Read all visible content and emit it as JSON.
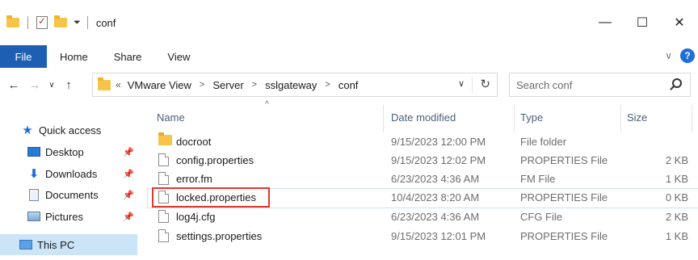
{
  "window": {
    "title": "conf",
    "controls": {
      "minimize": "—",
      "maximize": "☐",
      "close": "✕"
    }
  },
  "ribbon": {
    "tabs": [
      "File",
      "Home",
      "Share",
      "View"
    ],
    "collapse_glyph": "∨",
    "help_glyph": "?"
  },
  "nav": {
    "back": "←",
    "forward": "→",
    "recent": "∨",
    "up": "↑"
  },
  "address": {
    "overflow": "«",
    "crumbs": [
      "VMware View",
      "Server",
      "sslgateway",
      "conf"
    ],
    "dropdown": "∨",
    "refresh": "↻"
  },
  "search": {
    "placeholder": "Search conf"
  },
  "sidebar": {
    "items": [
      {
        "label": "Quick access",
        "icon": "star-icon"
      },
      {
        "label": "Desktop",
        "icon": "desktop-icon",
        "pinned": true
      },
      {
        "label": "Downloads",
        "icon": "downloads-icon",
        "pinned": true
      },
      {
        "label": "Documents",
        "icon": "documents-icon",
        "pinned": true
      },
      {
        "label": "Pictures",
        "icon": "pictures-icon",
        "pinned": true
      },
      {
        "label": "This PC",
        "icon": "pc-icon",
        "selected": true
      }
    ]
  },
  "columns": {
    "name": "Name",
    "date": "Date modified",
    "type": "Type",
    "size": "Size"
  },
  "files": [
    {
      "name": "docroot",
      "date": "9/15/2023 12:00 PM",
      "type": "File folder",
      "size": "",
      "kind": "folder"
    },
    {
      "name": "config.properties",
      "date": "9/15/2023 12:02 PM",
      "type": "PROPERTIES File",
      "size": "2 KB",
      "kind": "file"
    },
    {
      "name": "error.fm",
      "date": "6/23/2023 4:36 AM",
      "type": "FM File",
      "size": "1 KB",
      "kind": "file"
    },
    {
      "name": "locked.properties",
      "date": "10/4/2023 8:20 AM",
      "type": "PROPERTIES File",
      "size": "0 KB",
      "kind": "file",
      "highlighted": true
    },
    {
      "name": "log4j.cfg",
      "date": "6/23/2023 4:36 AM",
      "type": "CFG File",
      "size": "2 KB",
      "kind": "file"
    },
    {
      "name": "settings.properties",
      "date": "9/15/2023 12:01 PM",
      "type": "PROPERTIES File",
      "size": "1 KB",
      "kind": "file"
    }
  ],
  "colors": {
    "accent": "#1e5fb4",
    "highlight_box": "#e03a2e",
    "selection": "#cce4f7"
  }
}
